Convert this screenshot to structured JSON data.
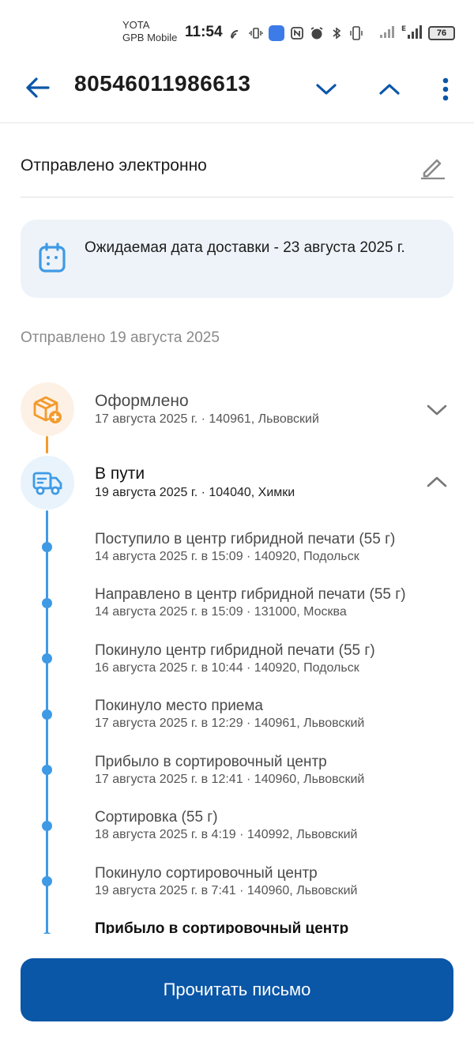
{
  "status_bar": {
    "carrier_line1": "YOTA",
    "carrier_line2": "GPB Mobile",
    "time": "11:54",
    "battery": "76"
  },
  "header": {
    "tracking_number": "80546011986613"
  },
  "sent": {
    "title": "Отправлено электронно"
  },
  "delivery": {
    "text": "Ожидаемая дата доставки - 23 августа 2025 г."
  },
  "sent_date": "Отправлено 19 августа 2025",
  "stages": [
    {
      "title": "Оформлено",
      "subtitle": "17 августа 2025 г. · 140961, Львовский"
    },
    {
      "title": "В пути",
      "subtitle": "19 августа 2025 г. · 104040, Химки"
    }
  ],
  "events": [
    {
      "title": "Поступило в центр гибридной печати (55 г)",
      "subtitle": "14 августа 2025 г. в 15:09 · 140920, Подольск"
    },
    {
      "title": "Направлено в центр гибридной печати (55 г)",
      "subtitle": "14 августа 2025 г. в 15:09 · 131000, Москва"
    },
    {
      "title": "Покинуло центр гибридной печати (55 г)",
      "subtitle": "16 августа 2025 г. в 10:44 · 140920, Подольск"
    },
    {
      "title": "Покинуло место приема",
      "subtitle": "17 августа 2025 г. в 12:29 · 140961, Львовский"
    },
    {
      "title": "Прибыло в сортировочный центр",
      "subtitle": "17 августа 2025 г. в 12:41 · 140960, Львовский"
    },
    {
      "title": "Сортировка (55 г)",
      "subtitle": "18 августа 2025 г. в 4:19 · 140992, Львовский"
    },
    {
      "title": "Покинуло сортировочный центр",
      "subtitle": "19 августа 2025 г. в 7:41 · 140960, Львовский"
    },
    {
      "title": "Прибыло в сортировочный центр"
    }
  ],
  "cta": {
    "label": "Прочитать письмо"
  },
  "colors": {
    "primary": "#0a56a7",
    "accent_blue": "#3f9ae6",
    "accent_orange": "#f39a2c",
    "card_bg": "#eef3f9"
  },
  "icons": {
    "back": "arrow-left-icon",
    "next": "chevron-down-icon",
    "prev": "chevron-up-icon",
    "more": "more-vertical-icon",
    "edit": "pencil-icon",
    "calendar": "calendar-icon",
    "stage_registered": "package-plus-icon",
    "stage_in_transit": "truck-icon"
  }
}
